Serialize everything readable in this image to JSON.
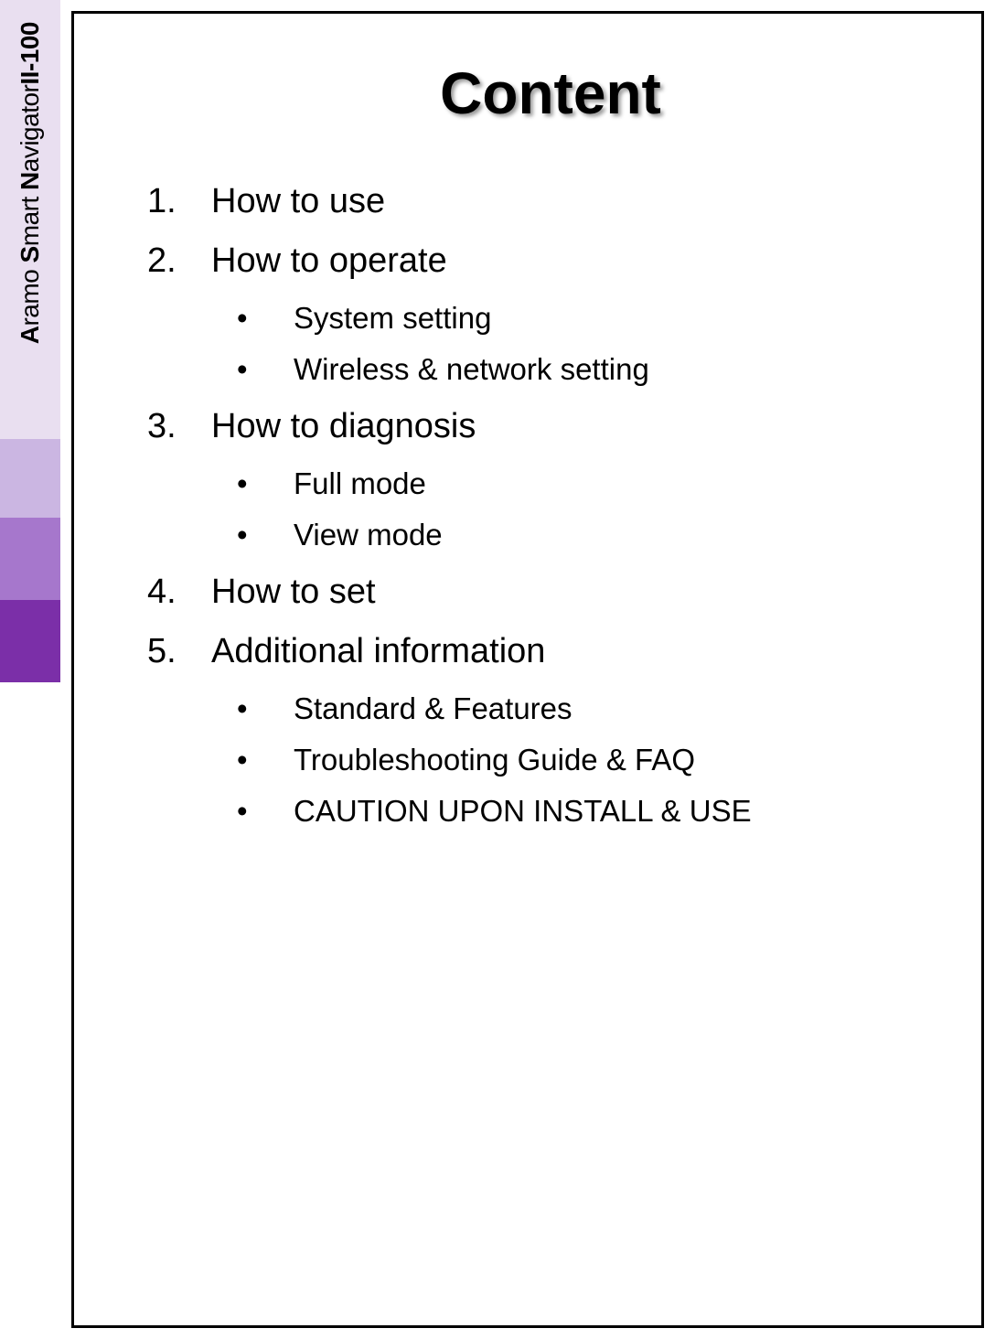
{
  "sidebar": {
    "brand": {
      "part1_bold": "A",
      "part1_rest": "ramo ",
      "part2_bold": "S",
      "part2_rest": "mart ",
      "part3_bold": "N",
      "part3_rest": "avigator",
      "part4_bold": "II-100"
    }
  },
  "page": {
    "title": "Content",
    "toc": [
      {
        "num": "1.",
        "label": "How to use",
        "subs": []
      },
      {
        "num": "2.",
        "label": "How to operate",
        "subs": [
          "System setting",
          "Wireless & network setting"
        ]
      },
      {
        "num": "3.",
        "label": "How to diagnosis",
        "subs": [
          "Full mode",
          "View mode"
        ]
      },
      {
        "num": "4.",
        "label": "How to set",
        "subs": []
      },
      {
        "num": "5.",
        "label": "Additional information",
        "subs": [
          "Standard & Features",
          "Troubleshooting Guide & FAQ",
          "CAUTION UPON INSTALL & USE"
        ]
      }
    ]
  }
}
